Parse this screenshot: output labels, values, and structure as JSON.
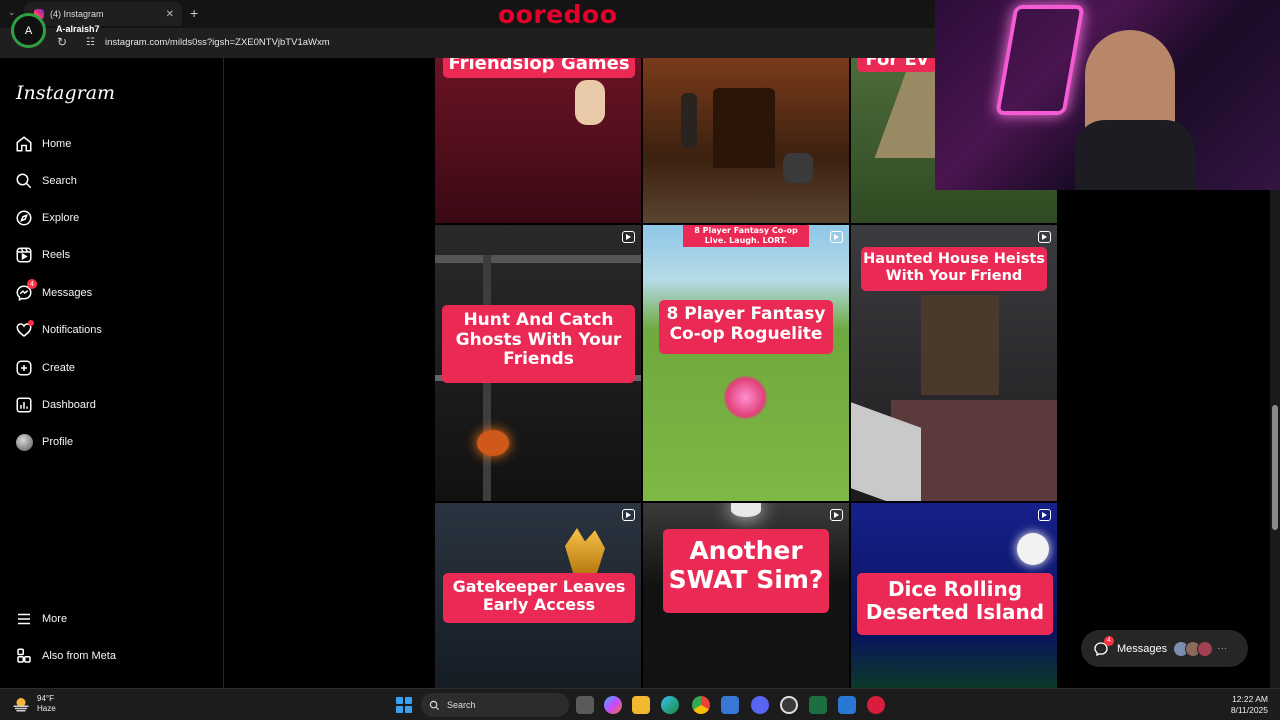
{
  "browser": {
    "tab_title": "(4) Instagram",
    "tab_close": "✕",
    "new_tab": "+",
    "tab_arrow": "⌄",
    "profile_initials": "A",
    "profile_name": "A-alraish7",
    "reload": "↻",
    "site_info": "☷",
    "url": "instagram.com/milds0ss?igsh=ZXE0NTVjbTV1aWxm",
    "brand_logo": "ooredoo"
  },
  "instagram": {
    "logo": "Instagram",
    "nav": [
      {
        "label": "Home",
        "icon": "home-icon"
      },
      {
        "label": "Search",
        "icon": "search-icon"
      },
      {
        "label": "Explore",
        "icon": "compass-icon"
      },
      {
        "label": "Reels",
        "icon": "reels-icon"
      },
      {
        "label": "Messages",
        "icon": "messenger-icon",
        "badge": "4"
      },
      {
        "label": "Notifications",
        "icon": "heart-icon"
      },
      {
        "label": "Create",
        "icon": "plus-square-icon"
      },
      {
        "label": "Dashboard",
        "icon": "chart-icon"
      },
      {
        "label": "Profile",
        "icon": "avatar"
      }
    ],
    "more": "More",
    "meta": "Also from Meta"
  },
  "posts": [
    {
      "caption": "Friendslop Games",
      "bg": "#5b0f1c"
    },
    {
      "caption": "",
      "bg": "#4a2a18"
    },
    {
      "caption": "For Ev",
      "bg": "#3e5a2a"
    },
    {
      "caption": "Hunt And Catch\nGhosts With Your\nFriends",
      "bg": "#1b1b1b"
    },
    {
      "caption": "8 Player Fantasy\nCo-op Roguelite",
      "top_caption": "8 Player Fantasy Co-op\nLive. Laugh. LORT.",
      "bg": "#6aa63c"
    },
    {
      "caption": "Haunted House Heists\nWith Your Friend",
      "bg": "#2a2a2c"
    },
    {
      "caption": "Gatekeeper Leaves\nEarly Access",
      "bg": "#1f2a35"
    },
    {
      "caption": "Another\nSWAT Sim?",
      "bg": "#151515"
    },
    {
      "caption": "Dice Rolling\nDeserted Island",
      "bg": "#0f1a6e"
    }
  ],
  "messages_pill": {
    "label": "Messages",
    "badge": "4",
    "more": "···"
  },
  "taskbar": {
    "temperature": "94°F",
    "condition": "Haze",
    "search_label": "Search",
    "time": "12:22 AM",
    "date": "8/11/2025"
  },
  "colors": {
    "caption_red": "#ea2a55",
    "notification_red": "#ff3040",
    "profile_ring": "#2ea043",
    "brand_red": "#e4002b"
  }
}
